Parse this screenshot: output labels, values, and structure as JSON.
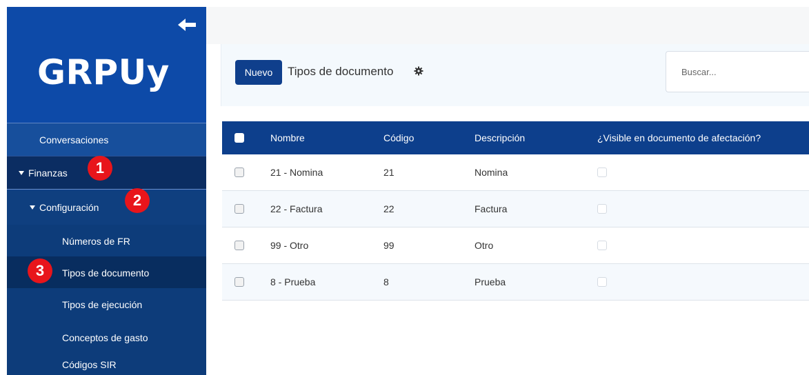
{
  "sidebar": {
    "logo": "GRPUy",
    "back_icon": "arrow-left-icon",
    "items": [
      {
        "label": "Conversaciones"
      },
      {
        "label": "Finanzas"
      },
      {
        "label": "Configuración"
      },
      {
        "label": "Números de FR"
      },
      {
        "label": "Tipos de documento"
      },
      {
        "label": "Tipos de ejecución"
      },
      {
        "label": "Conceptos de gasto"
      },
      {
        "label": "Códigos SIR"
      }
    ],
    "active_item": "Tipos de documento"
  },
  "annotations": [
    "1",
    "2",
    "3"
  ],
  "header": {
    "new_button": "Nuevo",
    "title": "Tipos de documento",
    "gear_icon": "gear-icon",
    "search_placeholder": "Buscar..."
  },
  "table": {
    "columns": [
      "Nombre",
      "Código",
      "Descripción",
      "¿Visible en documento de afectación?"
    ],
    "rows": [
      {
        "nombre": "21 - Nomina",
        "codigo": "21",
        "descripcion": "Nomina",
        "visible": false
      },
      {
        "nombre": "22 - Factura",
        "codigo": "22",
        "descripcion": "Factura",
        "visible": false
      },
      {
        "nombre": "99 - Otro",
        "codigo": "99",
        "descripcion": "Otro",
        "visible": false
      },
      {
        "nombre": "8 - Prueba",
        "codigo": "8",
        "descripcion": "Prueba",
        "visible": false
      }
    ]
  },
  "colors": {
    "primary": "#0f3f8c",
    "badge": "#e8151b"
  }
}
